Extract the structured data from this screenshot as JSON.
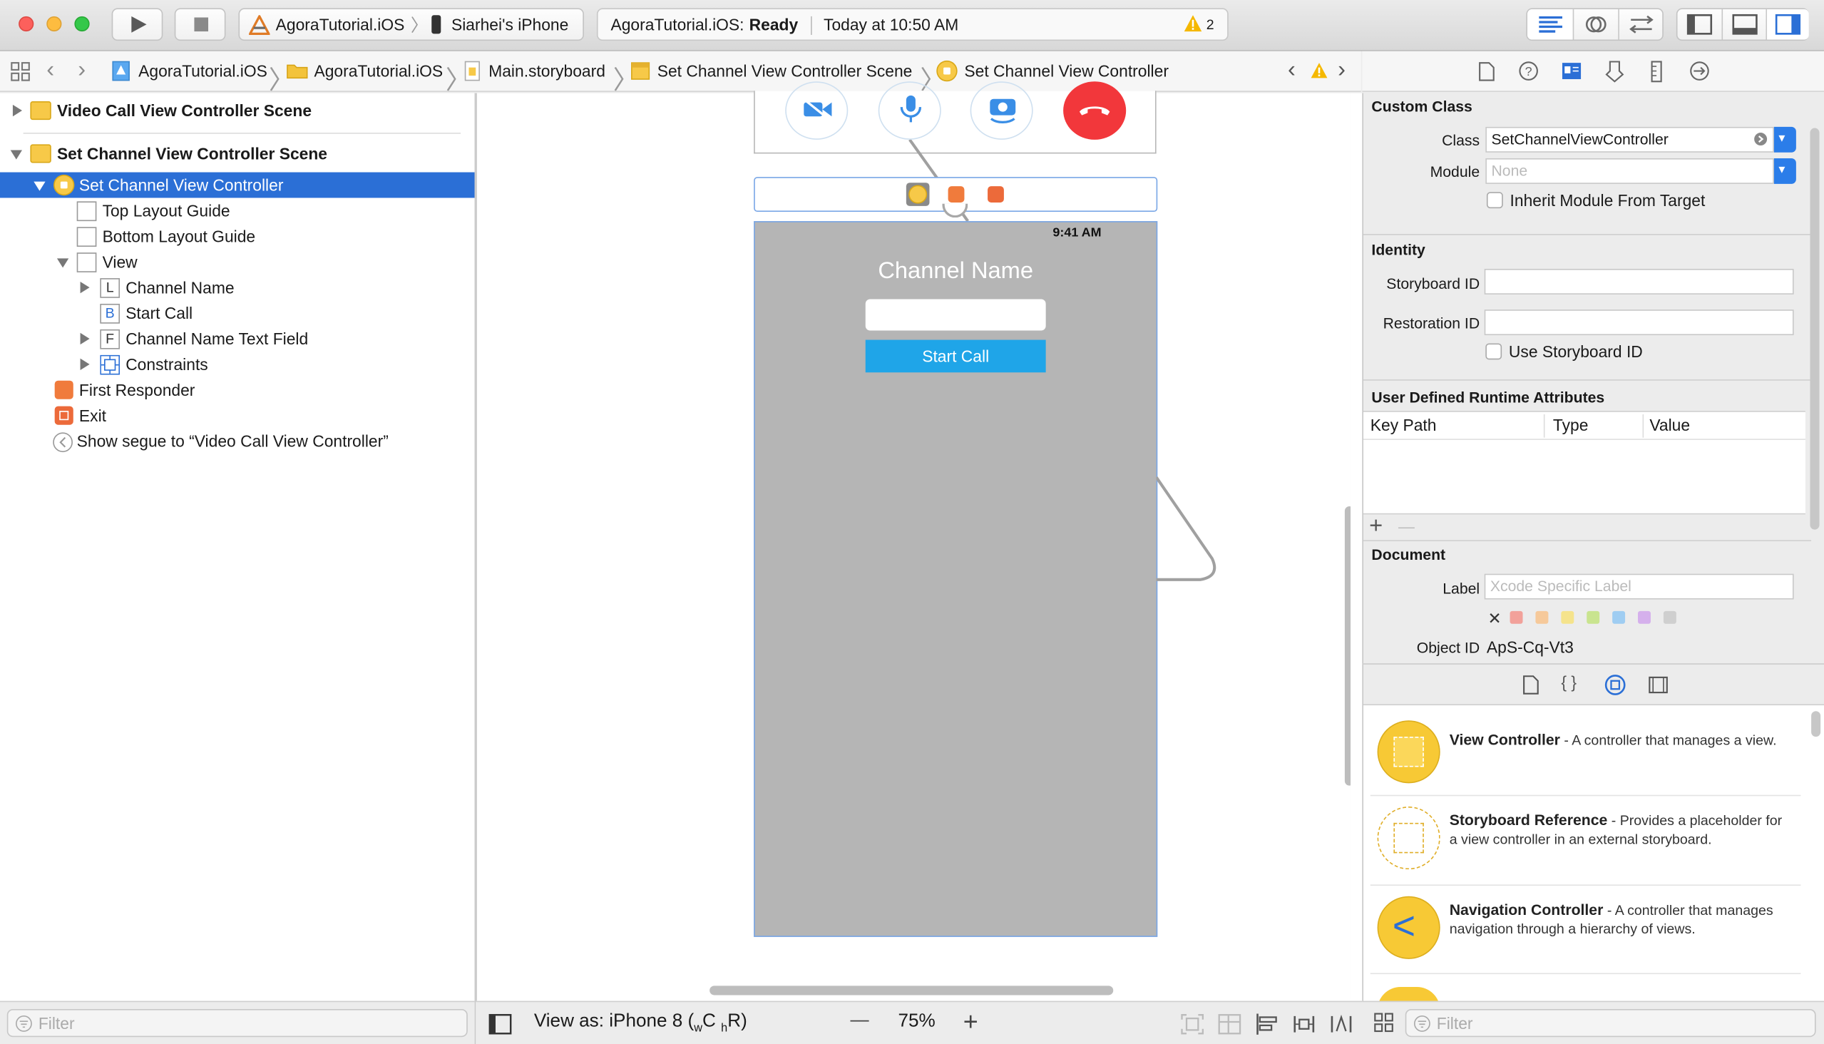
{
  "toolbar": {
    "scheme": "AgoraTutorial.iOS",
    "device": "Siarhei's iPhone",
    "status_project": "AgoraTutorial.iOS:",
    "status_state": "Ready",
    "status_time": "Today at 10:50 AM",
    "warning_count": "2"
  },
  "breadcrumb": {
    "items": [
      "AgoraTutorial.iOS",
      "AgoraTutorial.iOS",
      "Main.storyboard",
      "Set Channel View Controller Scene",
      "Set Channel View Controller"
    ]
  },
  "outline": {
    "scene1": "Video Call View Controller Scene",
    "scene2": "Set Channel View Controller Scene",
    "controller": "Set Channel View Controller",
    "top_layout": "Top Layout Guide",
    "bottom_layout": "Bottom Layout Guide",
    "view": "View",
    "channel_name": "Channel Name",
    "channel_name_badge": "L",
    "start_call": "Start Call",
    "start_call_badge": "B",
    "text_field": "Channel Name Text Field",
    "text_field_badge": "F",
    "constraints": "Constraints",
    "first_responder": "First Responder",
    "exit": "Exit",
    "segue": "Show segue to “Video Call View Controller”",
    "filter_placeholder": "Filter"
  },
  "canvas": {
    "status_time": "9:41 AM",
    "channel_label": "Channel Name",
    "start_button": "Start Call",
    "view_as": "View as: iPhone 8 (",
    "view_as_w": "w",
    "view_as_c": "C",
    "view_as_h": "h",
    "view_as_r": "R)",
    "zoom": "75%",
    "zoom_minus": "—",
    "zoom_plus": "+"
  },
  "inspector": {
    "custom_class_header": "Custom Class",
    "class_label": "Class",
    "class_value": "SetChannelViewController",
    "module_label": "Module",
    "module_placeholder": "None",
    "inherit_label": "Inherit Module From Target",
    "identity_header": "Identity",
    "storyboard_id_label": "Storyboard ID",
    "restoration_id_label": "Restoration ID",
    "use_storyboard_id": "Use Storyboard ID",
    "udra_header": "User Defined Runtime Attributes",
    "col_keypath": "Key Path",
    "col_type": "Type",
    "col_value": "Value",
    "add": "+",
    "remove": "—",
    "document_header": "Document",
    "doc_label": "Label",
    "doc_label_placeholder": "Xcode Specific Label",
    "object_id_label": "Object ID",
    "object_id_value": "ApS-Cq-Vt3",
    "label_colors": [
      "#f2a19a",
      "#f6c99a",
      "#f5e38c",
      "#c9e48f",
      "#9fcdf2",
      "#d5b0ec",
      "#cfcfcf"
    ]
  },
  "library": {
    "items": [
      {
        "title": "View Controller",
        "desc": " - A controller that manages a view."
      },
      {
        "title": "Storyboard Reference",
        "desc": " - Provides a placeholder for a view controller in an external storyboard."
      },
      {
        "title": "Navigation Controller",
        "desc": " - A controller that manages navigation through a hierarchy of views."
      }
    ],
    "filter_placeholder": "Filter"
  }
}
